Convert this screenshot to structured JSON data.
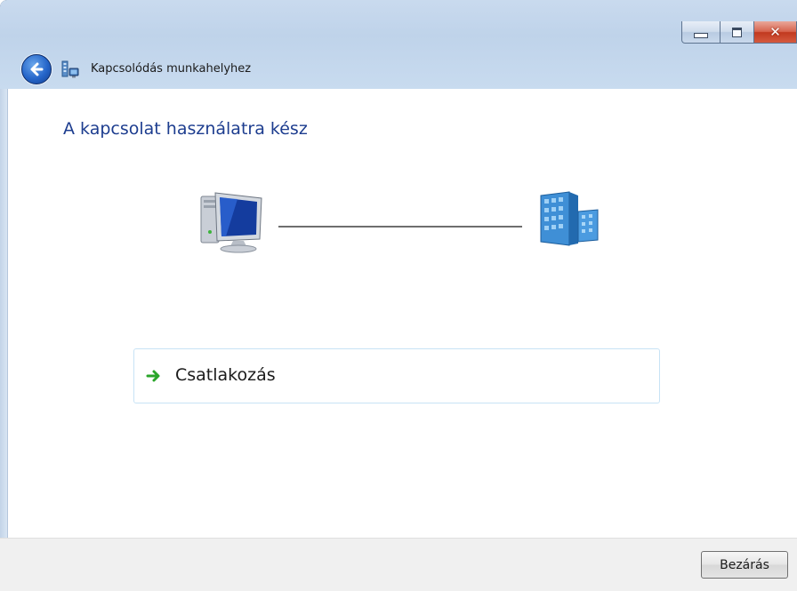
{
  "window": {
    "title": "Kapcsolódás munkahelyhez",
    "close_glyph": "✕"
  },
  "content": {
    "heading": "A kapcsolat használatra kész",
    "option_label": "Csatlakozás"
  },
  "footer": {
    "close_label": "Bezárás"
  },
  "icons": {
    "back": "back-arrow-icon",
    "wizard": "network-connection-icon",
    "computer": "computer-icon",
    "building": "office-building-icon",
    "arrow": "green-arrow-icon"
  },
  "colors": {
    "heading": "#1d3d8f",
    "titlebar": "#c9daee",
    "close_button": "#c1391f",
    "accent_green": "#2aa52a"
  }
}
